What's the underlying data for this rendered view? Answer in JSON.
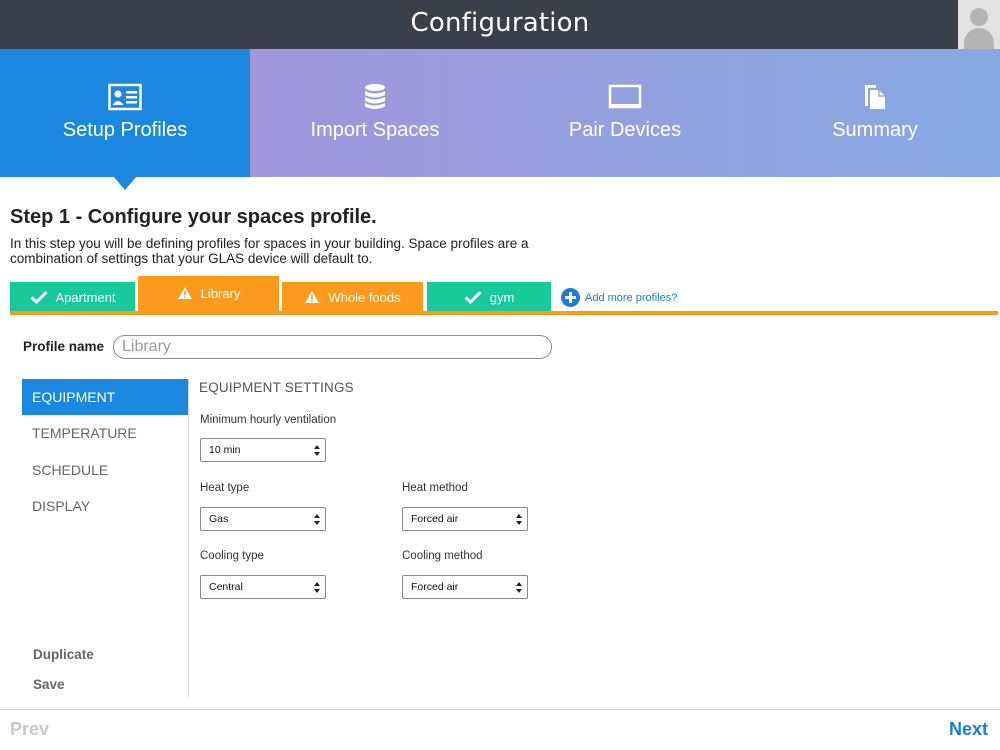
{
  "header": {
    "title": "Configuration"
  },
  "steps": [
    {
      "label": "Setup Profiles",
      "icon": "id-card-icon",
      "active": true
    },
    {
      "label": "Import Spaces",
      "icon": "database-icon",
      "active": false
    },
    {
      "label": "Pair Devices",
      "icon": "monitor-icon",
      "active": false
    },
    {
      "label": "Summary",
      "icon": "document-icon",
      "active": false
    }
  ],
  "step_content": {
    "heading": "Step 1 - Configure your spaces profile.",
    "description": "In this step you will be defining profiles for spaces in your building. Space profiles are a combination of settings that your GLAS device will default to."
  },
  "profile_tabs": [
    {
      "label": "Apartment",
      "status": "complete",
      "icon": "checkmark-icon",
      "color": "#18c99a"
    },
    {
      "label": "Library",
      "status": "warning",
      "icon": "warning-icon",
      "color": "#fb9a1c",
      "active": true
    },
    {
      "label": "Whole foods",
      "status": "warning",
      "icon": "warning-icon",
      "color": "#fb9a1c"
    },
    {
      "label": "gym",
      "status": "complete",
      "icon": "checkmark-icon",
      "color": "#18c99a"
    }
  ],
  "add_more_label": "Add more profiles?",
  "profile_name": {
    "label": "Profile name",
    "placeholder": "Library",
    "value": ""
  },
  "menu": {
    "items": [
      {
        "label": "EQUIPMENT",
        "active": true
      },
      {
        "label": "TEMPERATURE",
        "active": false
      },
      {
        "label": "SCHEDULE",
        "active": false
      },
      {
        "label": "DISPLAY",
        "active": false
      }
    ],
    "duplicate_label": "Duplicate",
    "save_label": "Save"
  },
  "equipment_settings": {
    "title": "EQUIPMENT SETTINGS",
    "min_ventilation": {
      "label": "Minimum hourly ventilation",
      "value": "10 min"
    },
    "heat_type": {
      "label": "Heat type",
      "value": "Gas"
    },
    "heat_method": {
      "label": "Heat method",
      "value": "Forced air"
    },
    "cooling_type": {
      "label": "Cooling type",
      "value": "Central"
    },
    "cooling_method": {
      "label": "Cooling method",
      "value": "Forced air"
    }
  },
  "footer": {
    "prev_label": "Prev",
    "next_label": "Next"
  },
  "colors": {
    "primary_blue": "#1c87de",
    "success_green": "#18c99a",
    "warning_orange": "#fb9a1c",
    "titlebar": "#3b3f4b"
  }
}
